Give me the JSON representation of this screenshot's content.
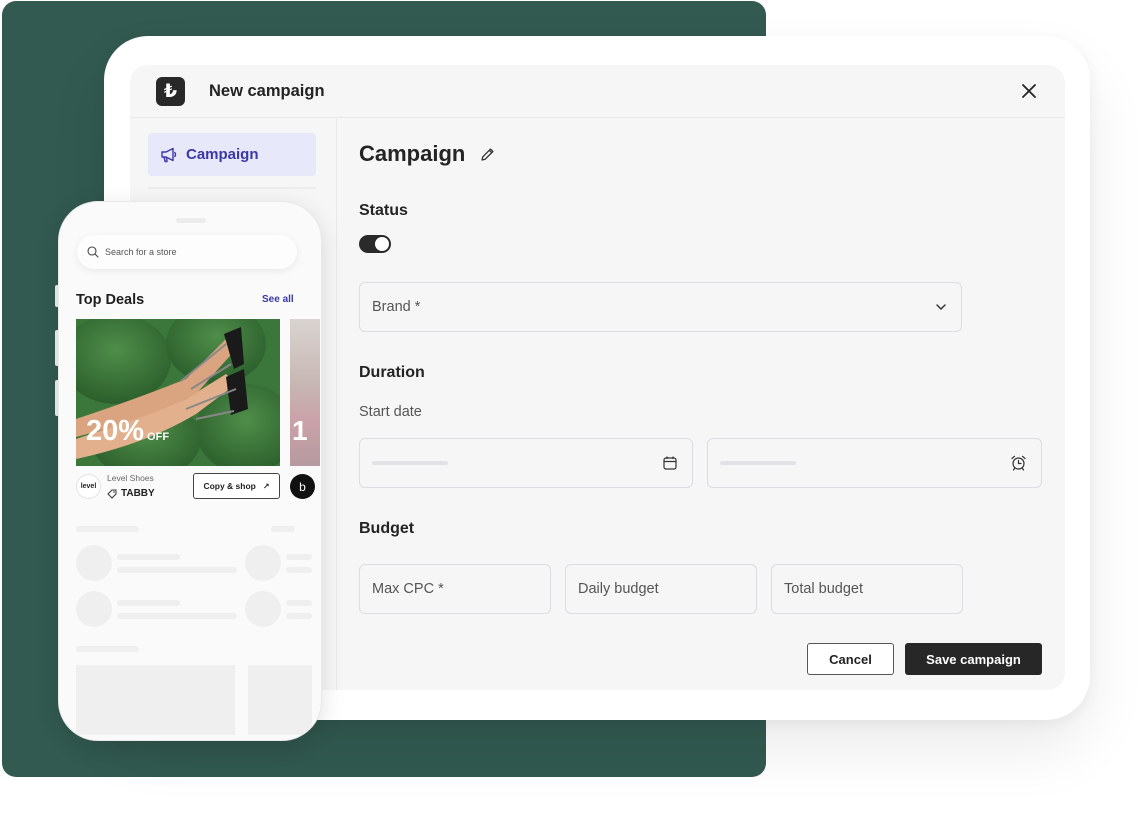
{
  "app": {
    "logo_glyph": "₺",
    "title": "New campaign",
    "close_icon": "close-icon"
  },
  "sidebar": {
    "items": [
      {
        "label": "Campaign",
        "icon": "megaphone-icon",
        "active": true
      }
    ]
  },
  "form": {
    "title": "Campaign",
    "status": {
      "label": "Status",
      "enabled": true
    },
    "brand": {
      "placeholder": "Brand *"
    },
    "duration": {
      "label": "Duration",
      "start_date_label": "Start date",
      "date_icon": "calendar-icon",
      "time_icon": "alarm-clock-icon"
    },
    "budget": {
      "label": "Budget",
      "fields": [
        {
          "placeholder": "Max CPC *"
        },
        {
          "placeholder": "Daily budget"
        },
        {
          "placeholder": "Total budget"
        }
      ]
    },
    "actions": {
      "cancel": "Cancel",
      "save": "Save campaign"
    }
  },
  "phone": {
    "search_placeholder": "Search for a store",
    "section_title": "Top Deals",
    "see_all": "See all",
    "deals": [
      {
        "discount": "20%",
        "discount_suffix": "OFF",
        "store_logo": "level",
        "store_name": "Level Shoes",
        "code": "TABBY",
        "cta": "Copy & shop",
        "cta_icon": "↗"
      },
      {
        "discount": "1",
        "store_logo": "b"
      }
    ]
  },
  "colors": {
    "brand_green": "#325a50",
    "accent_purple": "#3b37a8",
    "nav_active_bg": "#e8e8fb",
    "primary_button": "#272727"
  }
}
